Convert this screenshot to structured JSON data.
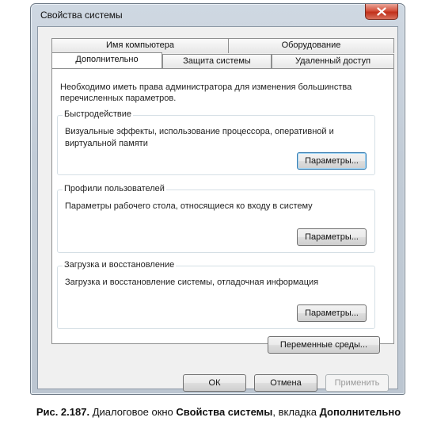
{
  "window": {
    "title": "Свойства системы"
  },
  "tabs": {
    "row1": [
      "Имя компьютера",
      "Оборудование"
    ],
    "row2": [
      "Дополнительно",
      "Защита системы",
      "Удаленный доступ"
    ]
  },
  "panel": {
    "intro": "Необходимо иметь права администратора для изменения большинства перечисленных параметров.",
    "performance": {
      "label": "Быстродействие",
      "description": "Визуальные эффекты, использование процессора, оперативной и виртуальной памяти",
      "button": "Параметры..."
    },
    "profiles": {
      "label": "Профили пользователей",
      "description": "Параметры рабочего стола, относящиеся ко входу в систему",
      "button": "Параметры..."
    },
    "startup": {
      "label": "Загрузка и восстановление",
      "description": "Загрузка и восстановление системы, отладочная информация",
      "button": "Параметры..."
    },
    "env_button": "Переменные среды..."
  },
  "footer": {
    "ok": "ОК",
    "cancel": "Отмена",
    "apply": "Применить"
  },
  "caption": {
    "fig": "Рис. 2.187.",
    "t1": " Диалоговое окно ",
    "b1": "Свойства системы",
    "t2": ", вкладка ",
    "b2": "Дополнительно"
  }
}
